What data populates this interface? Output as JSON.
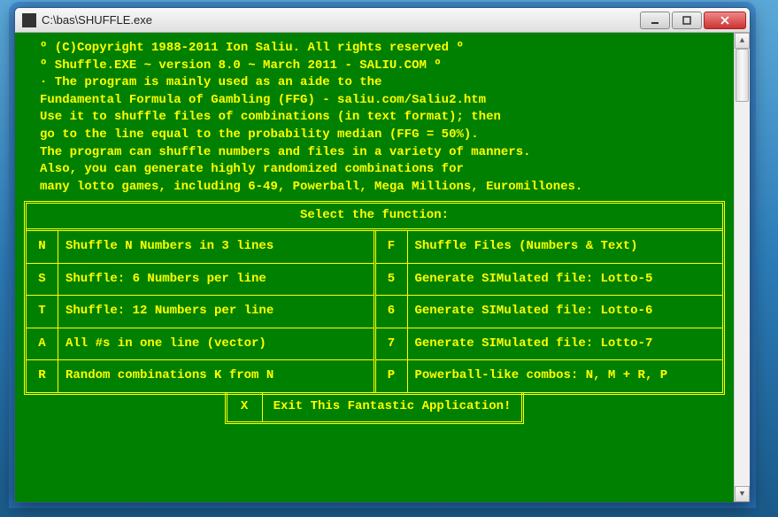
{
  "window": {
    "title": "C:\\bas\\SHUFFLE.exe"
  },
  "intro": {
    "l1": "º (C)Copyright 1988-2011 Ion Saliu. All rights reserved º",
    "l2": "º Shuffle.EXE ~ version 8.0 ~ March 2011 - SALIU.COM º",
    "l3": "· The program is mainly used as an aide to the",
    "l4": "Fundamental Formula of Gambling (FFG) - saliu.com/Saliu2.htm",
    "l5": "Use it to shuffle files of combinations (in text format); then",
    "l6": "go to the line equal to the probability median (FFG = 50%).",
    "l7": "The program can shuffle numbers and files in a variety of manners.",
    "l8": "Also, you can generate highly randomized combinations for",
    "l9": "many lotto games, including 6-49, Powerball, Mega Millions, Euromillones."
  },
  "menu": {
    "header": "Select the function:",
    "left": [
      {
        "key": "N",
        "desc": "Shuffle N Numbers in 3 lines"
      },
      {
        "key": "S",
        "desc": "Shuffle: 6 Numbers per line"
      },
      {
        "key": "T",
        "desc": "Shuffle: 12 Numbers per line"
      },
      {
        "key": "A",
        "desc": "All #s in one line (vector)"
      },
      {
        "key": "R",
        "desc": "Random combinations K from N"
      }
    ],
    "right": [
      {
        "key": "F",
        "desc": "Shuffle Files (Numbers & Text)"
      },
      {
        "key": "5",
        "desc": "Generate SIMulated file: Lotto-5"
      },
      {
        "key": "6",
        "desc": "Generate SIMulated file: Lotto-6"
      },
      {
        "key": "7",
        "desc": "Generate SIMulated file: Lotto-7"
      },
      {
        "key": "P",
        "desc": "Powerball-like combos: N, M + R, P"
      }
    ],
    "exit": {
      "key": "X",
      "desc": "Exit This Fantastic Application!"
    }
  }
}
